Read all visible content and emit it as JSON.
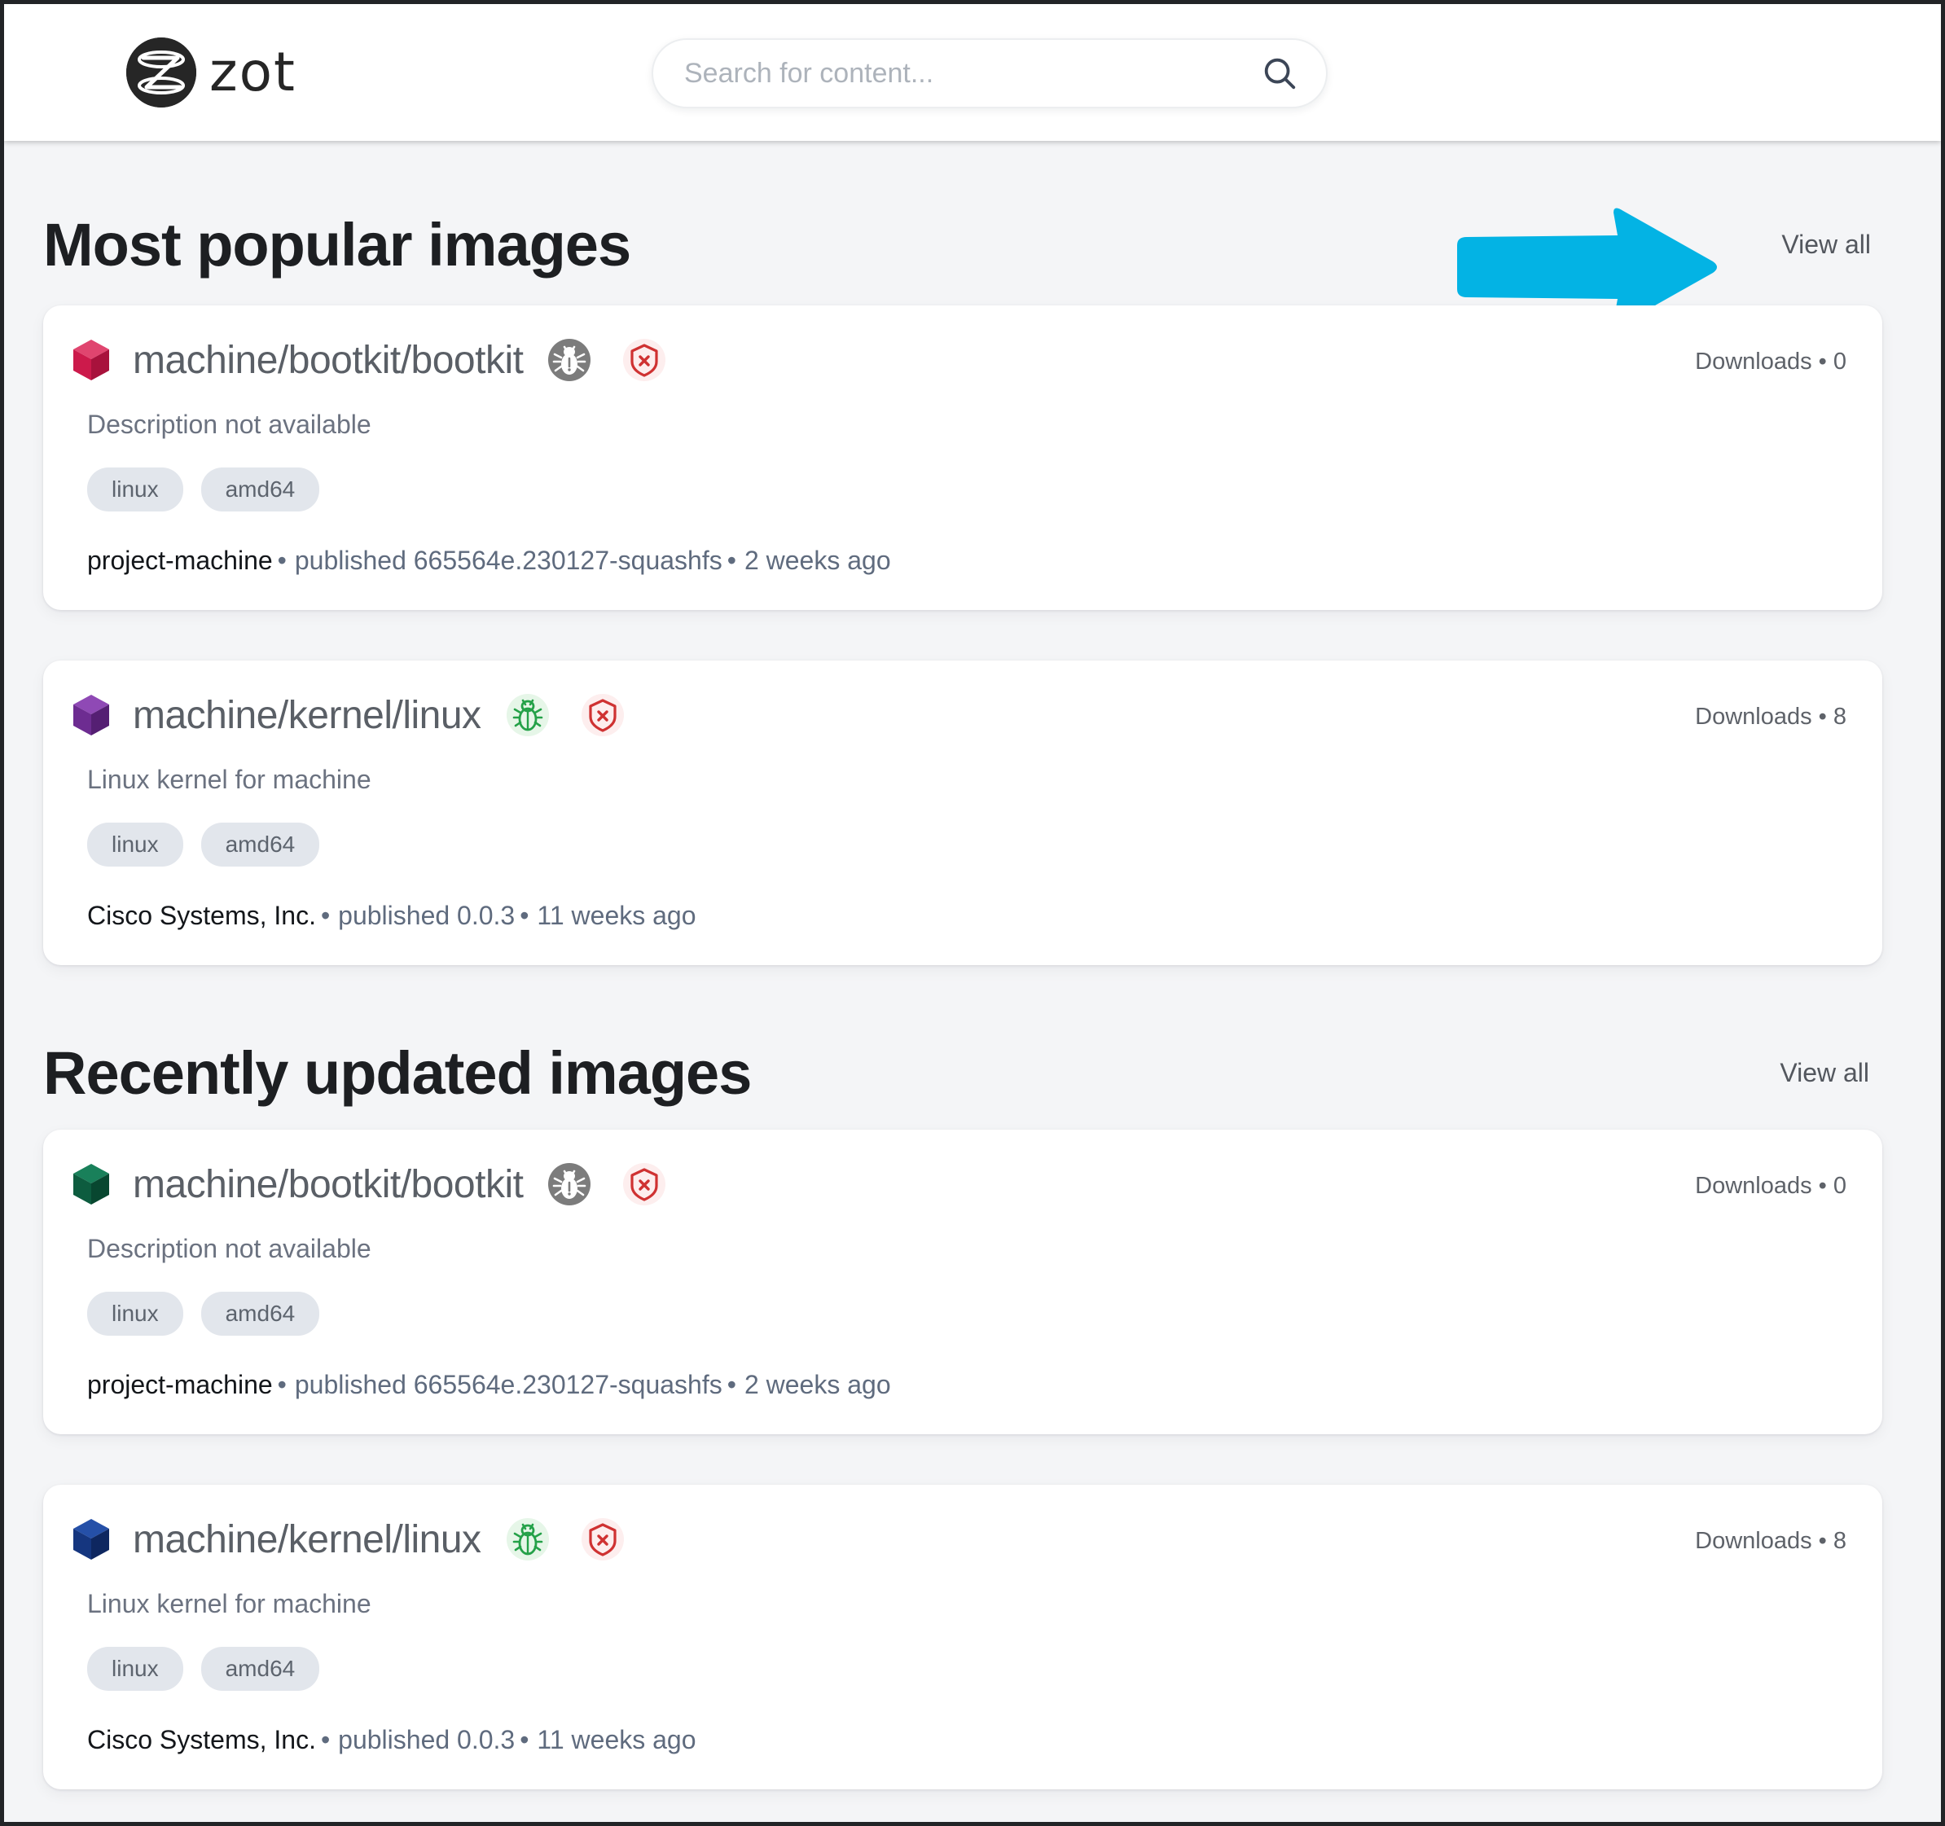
{
  "header": {
    "logo_text": "zot",
    "logo_icon": "zot-circle-logo",
    "search": {
      "placeholder": "Search for content...",
      "value": "",
      "icon": "search-icon"
    }
  },
  "annotation": {
    "arrow_icon": "right-arrow-annotation",
    "arrow_color": "#03b3e4"
  },
  "sections": [
    {
      "title": "Most popular images",
      "view_all": "View all",
      "cards": [
        {
          "cube_color": "#cc1a4b",
          "name": "machine/bootkit/bootkit",
          "badges": [
            "bug-unknown-icon",
            "shield-unverified-icon"
          ],
          "downloads": "Downloads • 0",
          "description": "Description not available",
          "tags": [
            "linux",
            "amd64"
          ],
          "vendor": "project-machine",
          "published": "published 665564e.230127-squashfs",
          "updated": "2 weeks ago"
        },
        {
          "cube_color": "#6d2c91",
          "name": "machine/kernel/linux",
          "badges": [
            "bug-ok-icon",
            "shield-unverified-icon"
          ],
          "downloads": "Downloads • 8",
          "description": "Linux kernel for machine",
          "tags": [
            "linux",
            "amd64"
          ],
          "vendor": "Cisco Systems, Inc.",
          "published": "published 0.0.3",
          "updated": "11 weeks ago"
        }
      ]
    },
    {
      "title": "Recently updated images",
      "view_all": "View all",
      "cards": [
        {
          "cube_color": "#0d5c3f",
          "name": "machine/bootkit/bootkit",
          "badges": [
            "bug-unknown-icon",
            "shield-unverified-icon"
          ],
          "downloads": "Downloads • 0",
          "description": "Description not available",
          "tags": [
            "linux",
            "amd64"
          ],
          "vendor": "project-machine",
          "published": "published 665564e.230127-squashfs",
          "updated": "2 weeks ago"
        },
        {
          "cube_color": "#15367f",
          "name": "machine/kernel/linux",
          "badges": [
            "bug-ok-icon",
            "shield-unverified-icon"
          ],
          "downloads": "Downloads • 8",
          "description": "Linux kernel for machine",
          "tags": [
            "linux",
            "amd64"
          ],
          "vendor": "Cisco Systems, Inc.",
          "published": "published 0.0.3",
          "updated": "11 weeks ago"
        }
      ]
    }
  ],
  "separators": {
    "dot": "•"
  }
}
